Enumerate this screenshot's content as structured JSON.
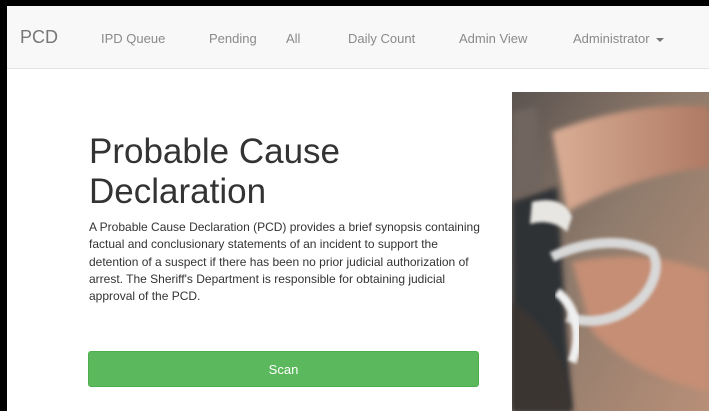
{
  "navbar": {
    "brand": "PCD",
    "items": [
      {
        "label": "IPD Queue"
      },
      {
        "label": "Pending"
      },
      {
        "label": "All"
      },
      {
        "label": "Daily Count"
      },
      {
        "label": "Admin View"
      },
      {
        "label": "Administrator"
      }
    ]
  },
  "main": {
    "title": "Probable Cause Declaration",
    "description": "A Probable Cause Declaration (PCD) provides a brief synopsis containing factual and conclusionary statements of an incident to support the detention of a suspect if there has been no prior judicial authorization of arrest. The Sheriff's Department is responsible for obtaining judicial approval of the PCD.",
    "scan_label": "Scan"
  },
  "colors": {
    "accent": "#5cb85c",
    "navbar_bg": "#f8f8f8"
  },
  "icons": {
    "dropdown": "caret-down-icon"
  }
}
